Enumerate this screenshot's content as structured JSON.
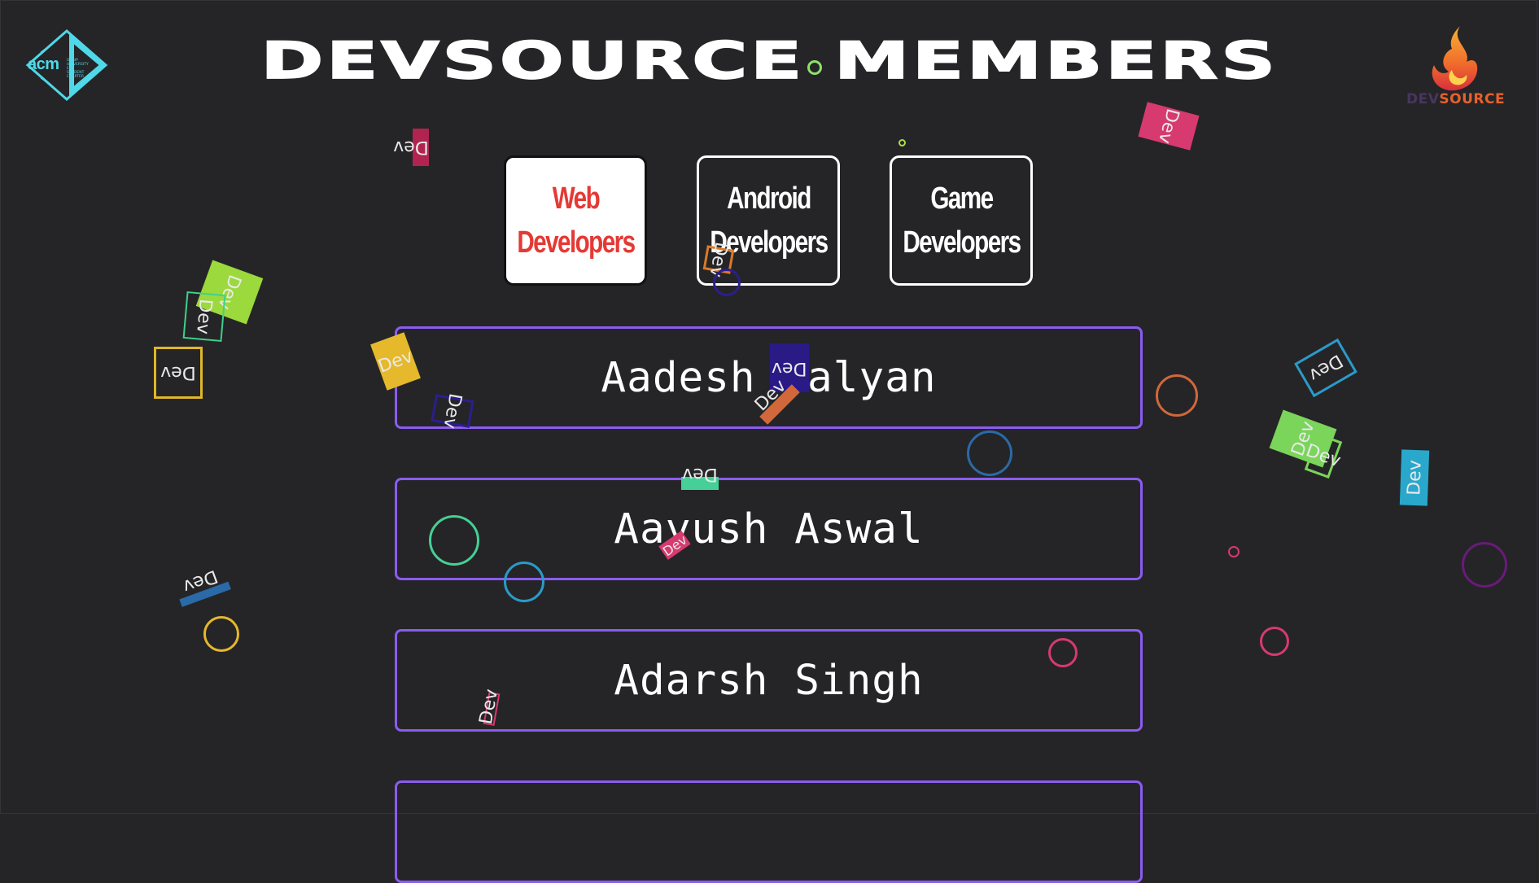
{
  "header": {
    "title": "DEVSOURCE MEMBERS",
    "acm_logo": {
      "text": "acm",
      "subtext": "GGSIP UNIVERSITY EDC STUDENT CHAPTER"
    },
    "brand_logo": {
      "text_dev": "DEV",
      "text_source": "SOURCE"
    }
  },
  "tabs": [
    {
      "label_line1": "Web",
      "label_line2": "Developers",
      "active": true
    },
    {
      "label_line1": "Android",
      "label_line2": "Developers",
      "active": false
    },
    {
      "label_line1": "Game",
      "label_line2": "Developers",
      "active": false
    }
  ],
  "members": [
    {
      "name": "Aadesh Balyan"
    },
    {
      "name": "Aayush Aswal"
    },
    {
      "name": "Adarsh Singh"
    },
    {
      "name": ""
    }
  ],
  "decoration": {
    "tag_text": "Dev",
    "colors": {
      "accent_purple": "#8a5cf0",
      "active_tab_text": "#e53935",
      "background": "#252527",
      "acm_cyan": "#4fd8e8",
      "brand_orange": "#e8612c"
    }
  }
}
